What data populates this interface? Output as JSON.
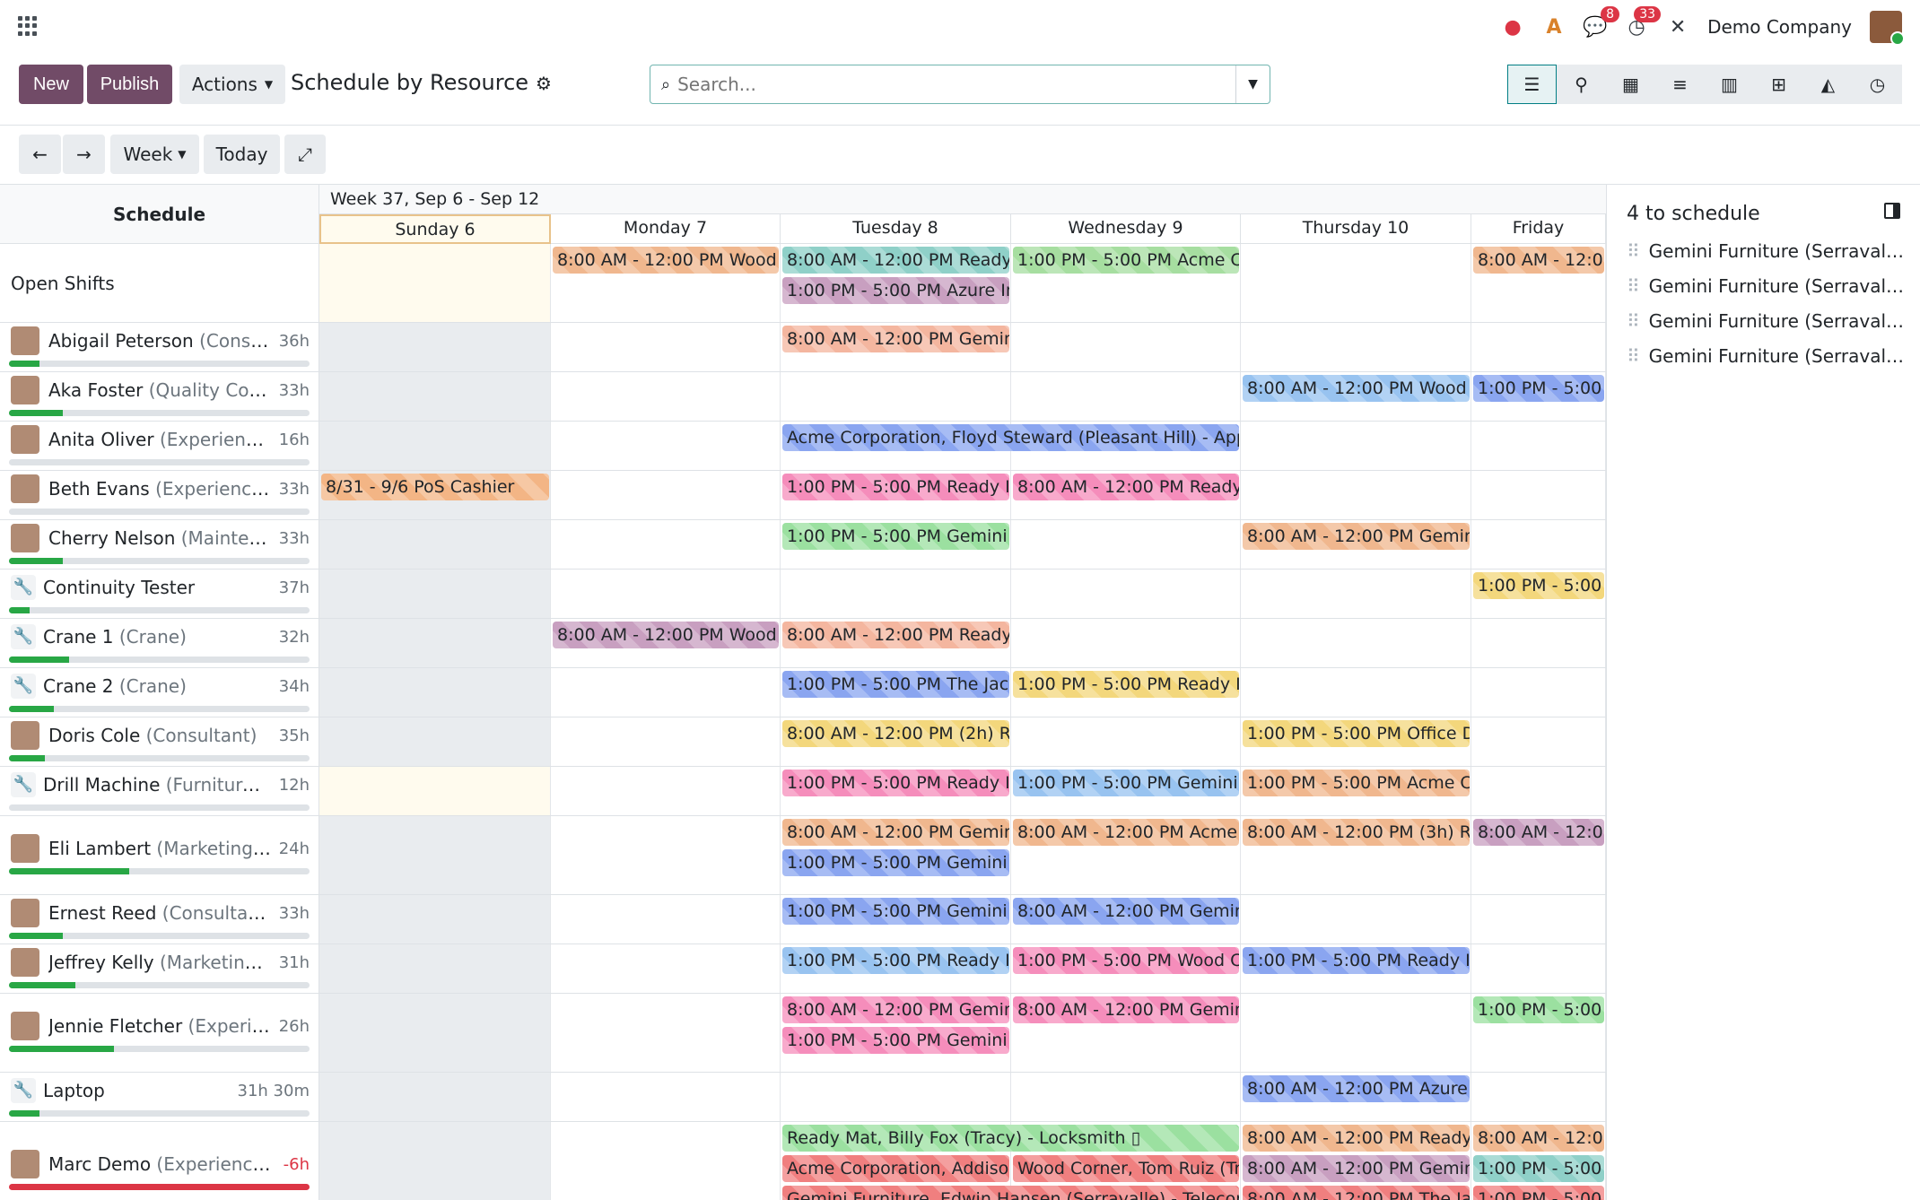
{
  "topbar": {
    "company": "Demo Company",
    "chat_badge": "8",
    "activity_badge": "33"
  },
  "control": {
    "new_label": "New",
    "publish_label": "Publish",
    "actions_label": "Actions",
    "title": "Schedule by Resource",
    "search_placeholder": "Search..."
  },
  "nav": {
    "week_label": "Week",
    "today_label": "Today"
  },
  "grid": {
    "schedule_label": "Schedule",
    "week_label": "Week 37, Sep 6 - Sep 12",
    "days": [
      "Sunday 6",
      "Monday 7",
      "Tuesday 8",
      "Wednesday 9",
      "Thursday 10",
      "Friday"
    ]
  },
  "rows": [
    {
      "name": "Open Shifts",
      "role": "",
      "hours": "",
      "progress": null
    },
    {
      "name": "Abigail Peterson",
      "role": "(Consul...",
      "hours": "36h",
      "progress": 0.1
    },
    {
      "name": "Aka Foster",
      "role": "(Quality Cont...",
      "hours": "33h",
      "progress": 0.18
    },
    {
      "name": "Anita Oliver",
      "role": "(Experience...",
      "hours": "16h",
      "progress": 0.0
    },
    {
      "name": "Beth Evans",
      "role": "(Experience...",
      "hours": "33h",
      "progress": 0.0
    },
    {
      "name": "Cherry Nelson",
      "role": "(Mainten...",
      "hours": "33h",
      "progress": 0.18
    },
    {
      "name": "Continuity Tester",
      "role": "",
      "hours": "37h",
      "progress": 0.07
    },
    {
      "name": "Crane 1",
      "role": "(Crane)",
      "hours": "32h",
      "progress": 0.2
    },
    {
      "name": "Crane 2",
      "role": "(Crane)",
      "hours": "34h",
      "progress": 0.15
    },
    {
      "name": "Doris Cole",
      "role": "(Consultant)",
      "hours": "35h",
      "progress": 0.12
    },
    {
      "name": "Drill Machine",
      "role": "(Furniture T...",
      "hours": "12h",
      "progress": 0.0
    },
    {
      "name": "Eli Lambert",
      "role": "(Marketing a...",
      "hours": "24h",
      "progress": 0.4
    },
    {
      "name": "Ernest Reed",
      "role": "(Consultant)",
      "hours": "33h",
      "progress": 0.18
    },
    {
      "name": "Jeffrey Kelly",
      "role": "(Marketing ...",
      "hours": "31h",
      "progress": 0.22
    },
    {
      "name": "Jennie Fletcher",
      "role": "(Experie...",
      "hours": "26h",
      "progress": 0.35
    },
    {
      "name": "Laptop",
      "role": "",
      "hours": "31h 30m",
      "progress": 0.1
    },
    {
      "name": "Marc Demo",
      "role": "(Experienced...",
      "hours": "-6h",
      "progress": 1.0
    }
  ],
  "shifts": [
    {
      "row": 0,
      "day": 1,
      "slot": 0,
      "text": "8:00 AM - 12:00 PM Wood",
      "color": "orange"
    },
    {
      "row": 0,
      "day": 2,
      "slot": 0,
      "text": "8:00 AM - 12:00 PM Ready",
      "color": "teal"
    },
    {
      "row": 0,
      "day": 2,
      "slot": 1,
      "text": "1:00 PM - 5:00 PM Azure In",
      "color": "purple"
    },
    {
      "row": 0,
      "day": 3,
      "slot": 0,
      "text": "1:00 PM - 5:00 PM Acme C",
      "color": "green"
    },
    {
      "row": 0,
      "day": 5,
      "slot": 0,
      "text": "8:00 AM - 12:00 PM",
      "color": "orange"
    },
    {
      "row": 1,
      "day": 2,
      "slot": 0,
      "text": "8:00 AM - 12:00 PM Gemini",
      "color": "salmon"
    },
    {
      "row": 2,
      "day": 4,
      "slot": 0,
      "text": "8:00 AM - 12:00 PM Wood",
      "color": "lblue"
    },
    {
      "row": 2,
      "day": 5,
      "slot": 0,
      "text": "1:00 PM - 5:00",
      "color": "blue"
    },
    {
      "row": 3,
      "day": 2,
      "slot": 0,
      "text": "Acme Corporation, Floyd Steward (Pleasant Hill) - App",
      "color": "blue",
      "span": 2
    },
    {
      "row": 4,
      "day": 0,
      "slot": 0,
      "text": "8/31 - 9/6 PoS Cashier",
      "color": "peach"
    },
    {
      "row": 4,
      "day": 2,
      "slot": 0,
      "text": "1:00 PM - 5:00 PM Ready I",
      "color": "pink"
    },
    {
      "row": 4,
      "day": 3,
      "slot": 0,
      "text": "8:00 AM - 12:00 PM Ready",
      "color": "pink"
    },
    {
      "row": 5,
      "day": 2,
      "slot": 0,
      "text": "1:00 PM - 5:00 PM Gemini",
      "color": "lgreen"
    },
    {
      "row": 5,
      "day": 4,
      "slot": 0,
      "text": "8:00 AM - 12:00 PM Gemini",
      "color": "orange"
    },
    {
      "row": 6,
      "day": 5,
      "slot": 0,
      "text": "1:00 PM - 5:00",
      "color": "yellow"
    },
    {
      "row": 7,
      "day": 1,
      "slot": 0,
      "text": "8:00 AM - 12:00 PM Wood",
      "color": "purple"
    },
    {
      "row": 7,
      "day": 2,
      "slot": 0,
      "text": "8:00 AM - 12:00 PM Ready",
      "color": "salmon"
    },
    {
      "row": 8,
      "day": 2,
      "slot": 0,
      "text": "1:00 PM - 5:00 PM The Jac",
      "color": "blue"
    },
    {
      "row": 8,
      "day": 3,
      "slot": 0,
      "text": "1:00 PM - 5:00 PM Ready I",
      "color": "yellow"
    },
    {
      "row": 9,
      "day": 2,
      "slot": 0,
      "text": "8:00 AM - 12:00 PM (2h) R",
      "color": "yellow"
    },
    {
      "row": 9,
      "day": 4,
      "slot": 0,
      "text": "1:00 PM - 5:00 PM Office D",
      "color": "yellow"
    },
    {
      "row": 10,
      "day": 2,
      "slot": 0,
      "text": "1:00 PM - 5:00 PM Ready I",
      "color": "pink"
    },
    {
      "row": 10,
      "day": 3,
      "slot": 0,
      "text": "1:00 PM - 5:00 PM Gemini",
      "color": "lblue"
    },
    {
      "row": 10,
      "day": 4,
      "slot": 0,
      "text": "1:00 PM - 5:00 PM Acme C",
      "color": "orange"
    },
    {
      "row": 11,
      "day": 2,
      "slot": 0,
      "text": "8:00 AM - 12:00 PM Gemini",
      "color": "orange"
    },
    {
      "row": 11,
      "day": 2,
      "slot": 1,
      "text": "1:00 PM - 5:00 PM Gemini",
      "color": "blue"
    },
    {
      "row": 11,
      "day": 3,
      "slot": 0,
      "text": "8:00 AM - 12:00 PM Acme",
      "color": "orange"
    },
    {
      "row": 11,
      "day": 4,
      "slot": 0,
      "text": "8:00 AM - 12:00 PM (3h) R",
      "color": "orange"
    },
    {
      "row": 11,
      "day": 5,
      "slot": 0,
      "text": "8:00 AM - 12:00",
      "color": "purple"
    },
    {
      "row": 12,
      "day": 2,
      "slot": 0,
      "text": "1:00 PM - 5:00 PM Gemini",
      "color": "blue"
    },
    {
      "row": 12,
      "day": 3,
      "slot": 0,
      "text": "8:00 AM - 12:00 PM Gemini",
      "color": "blue"
    },
    {
      "row": 13,
      "day": 2,
      "slot": 0,
      "text": "1:00 PM - 5:00 PM Ready I",
      "color": "lblue"
    },
    {
      "row": 13,
      "day": 3,
      "slot": 0,
      "text": "1:00 PM - 5:00 PM Wood C",
      "color": "pink"
    },
    {
      "row": 13,
      "day": 4,
      "slot": 0,
      "text": "1:00 PM - 5:00 PM Ready I",
      "color": "blue"
    },
    {
      "row": 14,
      "day": 2,
      "slot": 0,
      "text": "8:00 AM - 12:00 PM Gemini",
      "color": "pink"
    },
    {
      "row": 14,
      "day": 2,
      "slot": 1,
      "text": "1:00 PM - 5:00 PM Gemini",
      "color": "pink"
    },
    {
      "row": 14,
      "day": 3,
      "slot": 0,
      "text": "8:00 AM - 12:00 PM Gemini",
      "color": "pink"
    },
    {
      "row": 14,
      "day": 5,
      "slot": 0,
      "text": "1:00 PM - 5:00",
      "color": "lgreen"
    },
    {
      "row": 15,
      "day": 4,
      "slot": 0,
      "text": "8:00 AM - 12:00 PM Azure",
      "color": "blue"
    },
    {
      "row": 16,
      "day": 2,
      "slot": 0,
      "text": "Ready Mat, Billy Fox (Tracy) - Locksmith ▯",
      "color": "lgreen",
      "span": 2
    },
    {
      "row": 16,
      "day": 2,
      "slot": 1,
      "text": "Acme Corporation, Addison",
      "color": "red"
    },
    {
      "row": 16,
      "day": 2,
      "slot": 2,
      "text": "Gemini Furniture, Edwin Hansen (Serravalle) - Telecom",
      "color": "red",
      "span": 2
    },
    {
      "row": 16,
      "day": 3,
      "slot": 1,
      "text": "Wood Corner, Tom Ruiz (Tr",
      "color": "red"
    },
    {
      "row": 16,
      "day": 4,
      "slot": 0,
      "text": "8:00 AM - 12:00 PM Ready",
      "color": "orange"
    },
    {
      "row": 16,
      "day": 4,
      "slot": 1,
      "text": "8:00 AM - 12:00 PM Gemini",
      "color": "purple"
    },
    {
      "row": 16,
      "day": 4,
      "slot": 2,
      "text": "8:00 AM - 12:00 PM The Ja",
      "color": "red"
    },
    {
      "row": 16,
      "day": 5,
      "slot": 0,
      "text": "8:00 AM - 12:00",
      "color": "orange"
    },
    {
      "row": 16,
      "day": 5,
      "slot": 1,
      "text": "1:00 PM - 5:00",
      "color": "teal"
    },
    {
      "row": 16,
      "day": 5,
      "slot": 2,
      "text": "1:00 PM - 5:00",
      "color": "red"
    }
  ],
  "side": {
    "title": "4 to schedule",
    "items": [
      "Gemini Furniture (Serravalle) - ...",
      "Gemini Furniture (Serravalle) - ...",
      "Gemini Furniture (Serravalle) - ...",
      "Gemini Furniture (Serravalle) - ..."
    ]
  }
}
